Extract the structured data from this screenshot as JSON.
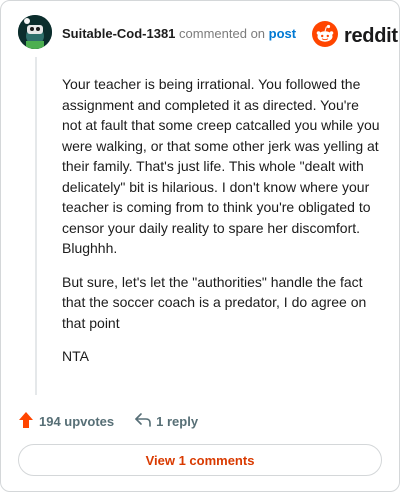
{
  "comment": {
    "username": "Suitable-Cod-1381",
    "commented_text": "commented on",
    "post_link": "post",
    "paragraphs": [
      "Your teacher is being irrational. You followed the assignment and completed it as directed. You're not at fault that some creep catcalled you while you were walking, or that some other jerk was yelling at their family. That's just life. This whole \"dealt with delicately\" bit is hilarious. I don't know where your teacher is coming from to think you're obligated to censor your daily reality to spare her discomfort. Blughhh.",
      "But sure, let's let the \"authorities\" handle the fact that the soccer coach is a predator, I do agree on that point",
      "NTA"
    ]
  },
  "brand": {
    "wordmark": "reddit"
  },
  "actions": {
    "upvotes": "194 upvotes",
    "replies": "1 reply"
  },
  "view_button": "View 1 comments",
  "colors": {
    "brand_orange": "#ff4500",
    "upvote_arrow": "#ff4500",
    "link_blue": "#0079d3",
    "view_button_text": "#d93a00"
  },
  "icons": [
    "avatar",
    "reddit-logo-icon",
    "upvote-arrow-icon",
    "reply-arrow-icon"
  ]
}
